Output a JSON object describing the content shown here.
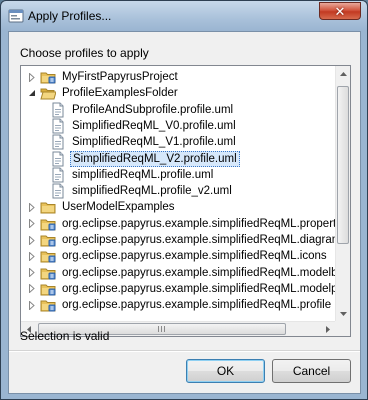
{
  "window": {
    "title": "Apply Profiles...",
    "close_symbol": "✕"
  },
  "dialog": {
    "heading": "Choose profiles to apply",
    "status": "Selection is valid",
    "ok_label": "OK",
    "cancel_label": "Cancel"
  },
  "tree": {
    "items": [
      {
        "label": "MyFirstPapyrusProject",
        "type": "project",
        "expanded": false
      },
      {
        "label": "ProfileExamplesFolder",
        "type": "folder-open",
        "expanded": true
      },
      {
        "label": "ProfileAndSubprofile.profile.uml",
        "type": "file"
      },
      {
        "label": "SimplifiedReqML_V0.profile.uml",
        "type": "file"
      },
      {
        "label": "SimplifiedReqML_V1.profile.uml",
        "type": "file"
      },
      {
        "label": "SimplifiedReqML_V2.profile.uml",
        "type": "file",
        "selected": true
      },
      {
        "label": "simplifiedReqML.profile.uml",
        "type": "file"
      },
      {
        "label": "simplifiedReqML.profile_v2.uml",
        "type": "file"
      },
      {
        "label": "UserModelExpamples",
        "type": "folder",
        "expanded": false
      },
      {
        "label": "org.eclipse.papyrus.example.simplifiedReqML.properties",
        "type": "project",
        "expanded": false
      },
      {
        "label": "org.eclipse.papyrus.example.simplifiedReqML.diagrameditor",
        "type": "project",
        "expanded": false
      },
      {
        "label": "org.eclipse.papyrus.example.simplifiedReqML.icons",
        "type": "project",
        "expanded": false
      },
      {
        "label": "org.eclipse.papyrus.example.simplifiedReqML.modelbrowser",
        "type": "project",
        "expanded": false
      },
      {
        "label": "org.eclipse.papyrus.example.simplifiedReqML.modelproject",
        "type": "project",
        "expanded": false
      },
      {
        "label": "org.eclipse.papyrus.example.simplifiedReqML.profile",
        "type": "project",
        "expanded": false
      }
    ]
  },
  "colors": {
    "selection_bg": "#d6e8fb",
    "selection_border": "#3a78c8",
    "folder": "#e8c15a",
    "project": "#5a8ed0"
  }
}
